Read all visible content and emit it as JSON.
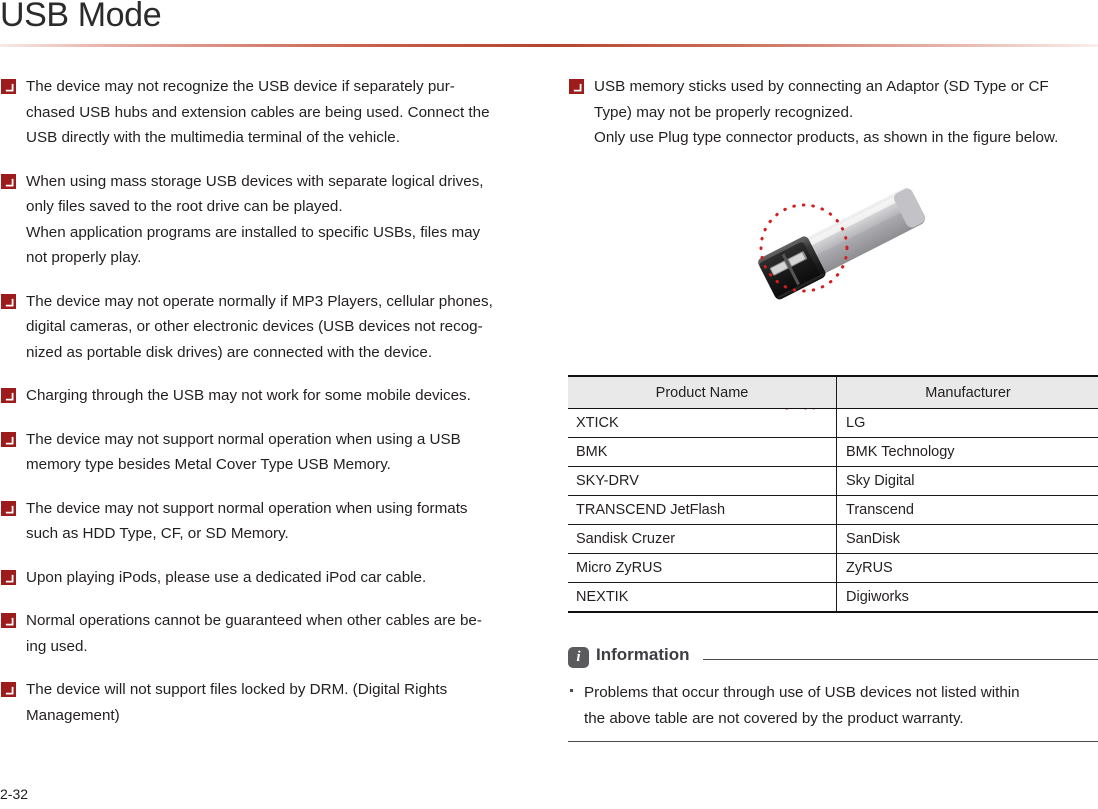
{
  "page": {
    "title": "USB Mode",
    "number": "2-32"
  },
  "left_column": {
    "notes": [
      {
        "icon": "arrow-down-right-icon",
        "lines": [
          "The device may not recognize the USB device if separately pur-",
          "chased USB hubs and extension cables are being used. Connect the",
          "USB directly with the multimedia terminal of the vehicle."
        ]
      },
      {
        "icon": "arrow-down-right-icon",
        "lines": [
          "When using mass storage USB devices with separate logical drives,",
          "only files saved to the root drive can be played.",
          "When application programs are installed to specific USBs, files may",
          "not properly play."
        ]
      },
      {
        "icon": "arrow-down-right-icon",
        "lines": [
          "The device may not operate normally if MP3 Players, cellular phones,",
          "digital cameras, or other electronic devices (USB devices not recog-",
          "nized as portable disk drives) are connected with the device."
        ]
      },
      {
        "icon": "arrow-down-right-icon",
        "lines": [
          "Charging through the USB may not work for some mobile devices."
        ]
      },
      {
        "icon": "arrow-down-right-icon",
        "lines": [
          "The device may not support normal operation when using a USB",
          "memory type besides Metal Cover Type USB Memory."
        ]
      },
      {
        "icon": "arrow-down-right-icon",
        "lines": [
          "The device may not support normal operation when using formats",
          "such as HDD Type, CF, or SD Memory."
        ]
      },
      {
        "icon": "arrow-down-right-icon",
        "lines": [
          "Upon playing iPods, please use a dedicated iPod car cable."
        ]
      },
      {
        "icon": "arrow-down-right-icon",
        "lines": [
          "Normal operations cannot be guaranteed when other cables are be-",
          "ing used."
        ]
      },
      {
        "icon": "arrow-down-right-icon",
        "lines": [
          "The device will not support files locked by DRM. (Digital Rights",
          "Management)"
        ]
      }
    ]
  },
  "right_column": {
    "notes": [
      {
        "icon": "arrow-down-right-icon",
        "lines": [
          "USB memory sticks used by connecting an Adaptor (SD Type or CF",
          "Type) may not be properly recognized.",
          "Only use Plug type connector products, as shown in the figure below."
        ]
      }
    ],
    "figure": {
      "name": "usb-plug-connector-illustration",
      "caption": "Plug Type Connector",
      "highlight_shape": "dotted-circle"
    },
    "table": {
      "headers": [
        "Product Name",
        "Manufacturer"
      ],
      "rows": [
        [
          "XTICK",
          "LG"
        ],
        [
          "BMK",
          "BMK Technology"
        ],
        [
          "SKY-DRV",
          "Sky Digital"
        ],
        [
          "TRANSCEND JetFlash",
          "Transcend"
        ],
        [
          "Sandisk Cruzer",
          "SanDisk"
        ],
        [
          "Micro ZyRUS",
          "ZyRUS"
        ],
        [
          "NEXTIK",
          "Digiworks"
        ]
      ]
    },
    "information": {
      "icon": "info-icon",
      "title": "Information",
      "bullet_lines": [
        "Problems that occur through use of USB devices not listed within",
        "the above table are not covered by the product warranty."
      ]
    }
  },
  "colors": {
    "accent_red": "#b02424",
    "marker_red": "#9e1b1b",
    "rule_red": "#b4442f",
    "text": "#231f20",
    "table_header_bg": "#e9e9e9",
    "info_icon_bg": "#5b5b5f"
  }
}
